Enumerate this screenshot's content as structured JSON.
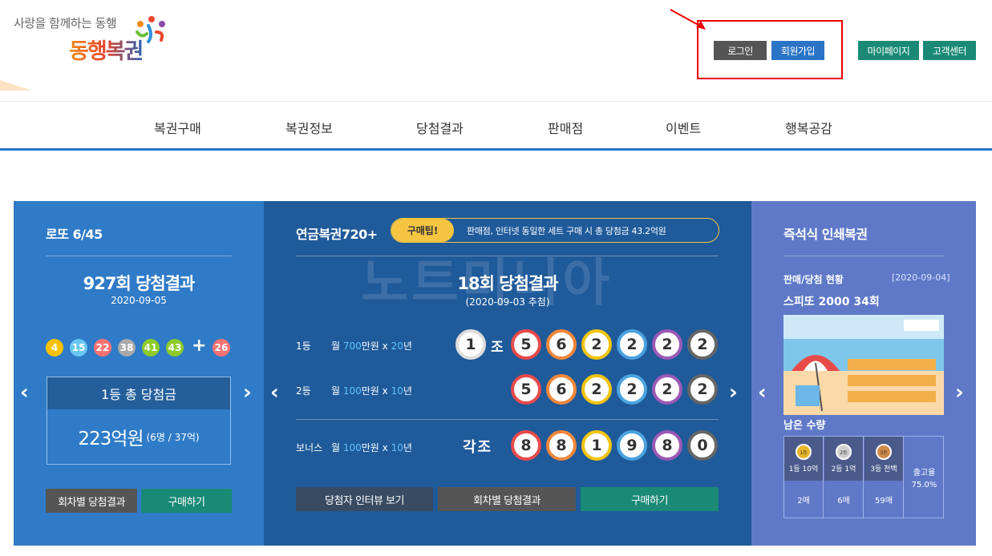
{
  "header": {
    "slogan": "사랑을 함께하는 동행",
    "logo": "동행복권",
    "login": "로그인",
    "join": "회원가입",
    "mypage": "마이페이지",
    "support": "고객센터"
  },
  "nav": [
    "복권구매",
    "복권정보",
    "당첨결과",
    "판매점",
    "이벤트",
    "행복공감"
  ],
  "lotto": {
    "title": "로또 6/45",
    "round_title": "927회 당첨결과",
    "date": "2020-09-05",
    "balls": [
      {
        "num": "4",
        "color": "#f9c300"
      },
      {
        "num": "15",
        "color": "#69c8f2"
      },
      {
        "num": "22",
        "color": "#ff7272"
      },
      {
        "num": "38",
        "color": "#aaaaaa"
      },
      {
        "num": "41",
        "color": "#8ccb2a"
      },
      {
        "num": "43",
        "color": "#8ccb2a"
      }
    ],
    "plus": "+",
    "bonus": {
      "num": "26",
      "color": "#ff7272"
    },
    "prize_label": "1등 총 당첨금",
    "prize_amount": "223억원",
    "prize_detail": "(6명 / 37억)",
    "btn_results": "회차별 당첨결과",
    "btn_buy": "구매하기"
  },
  "pension": {
    "title": "연금복권720+",
    "tip_label": "구매팁!",
    "tip_text": "판매점, 인터넷 동일한 세트 구매 시 총 당첨금 43.2억원",
    "round_title": "18회 당첨결과",
    "date": "(2020-09-03 추첨)",
    "watermark": "노트미니아",
    "rank1": {
      "label": "1등",
      "pre": "월 ",
      "amount": "700",
      "unit": "만원 x ",
      "years": "20",
      "suffix": "년"
    },
    "rank2": {
      "label": "2등",
      "pre": "월 ",
      "amount": "100",
      "unit": "만원 x ",
      "years": "10",
      "suffix": "년"
    },
    "bonus": {
      "label": "보너스",
      "pre": "월 ",
      "amount": "100",
      "unit": "만원 x ",
      "years": "10",
      "suffix": "년"
    },
    "jo_num": "1",
    "jo": "조",
    "each_jo": "각조",
    "row1": [
      "5",
      "6",
      "2",
      "2",
      "2",
      "2"
    ],
    "row2": [
      "5",
      "6",
      "2",
      "2",
      "2",
      "2"
    ],
    "row3": [
      "8",
      "8",
      "1",
      "9",
      "8",
      "0"
    ],
    "ring_colors": [
      "#e84a4a",
      "#f0873a",
      "#f1c40f",
      "#4aa3df",
      "#9b59b6",
      "#666666"
    ],
    "btn_interview": "당첨자 인터뷰 보기",
    "btn_results": "회차별 당첨결과",
    "btn_buy": "구매하기"
  },
  "instant": {
    "title": "즉석식 인쇄복권",
    "status_label": "판매/당첨 현황",
    "status_date": "[2020-09-04]",
    "game": "스피또 2000 34회",
    "remaining": "남은 수량",
    "tiers": [
      {
        "medal": "1등",
        "label": "1등 10억",
        "count": "2매"
      },
      {
        "medal": "2등",
        "label": "2등 1억",
        "count": "6매"
      },
      {
        "medal": "3등",
        "label": "3등 천백",
        "count": "59매"
      }
    ],
    "rate_label": "출고율",
    "rate": "75.0%"
  }
}
